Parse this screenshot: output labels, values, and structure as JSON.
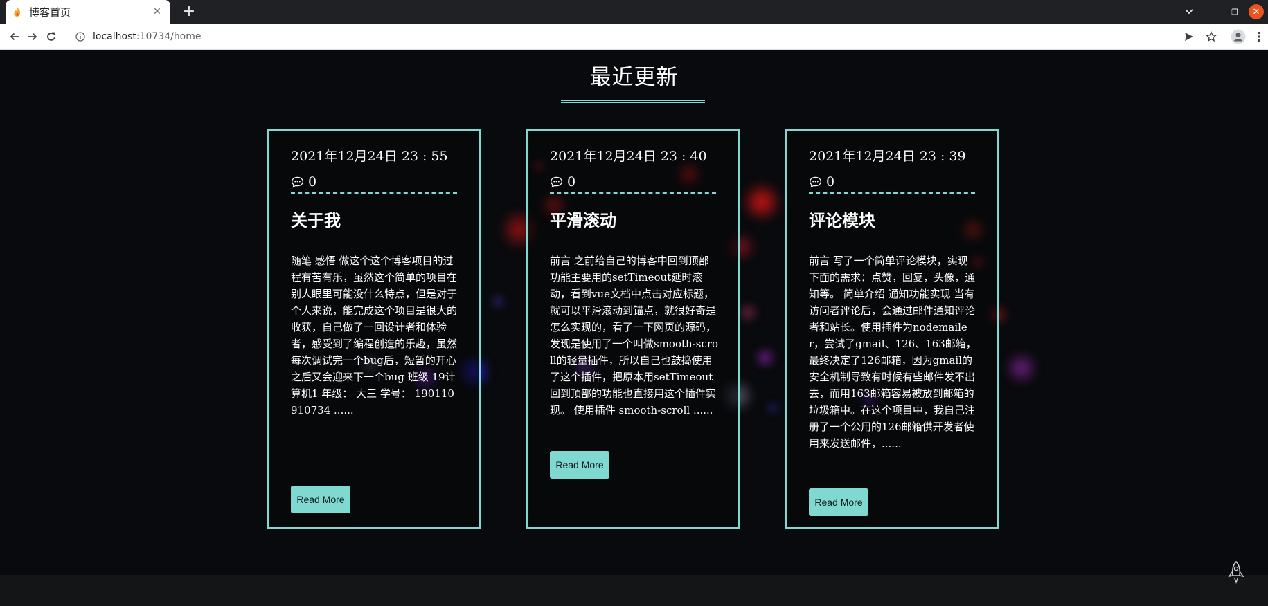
{
  "browser": {
    "tab_title": "博客首页",
    "tab_close": "✕",
    "new_tab": "+",
    "url_host": "localhost",
    "url_rest": ":10734/home",
    "window_controls": {
      "minimize": "–",
      "restore": "❐",
      "close": "✕",
      "list": "⌄"
    }
  },
  "page": {
    "section_title": "最近更新",
    "accent_color": "#7fd9d1",
    "background_color": "#090a0d",
    "cards": [
      {
        "date": "2021年12月24日 23 : 55",
        "comment_count": "0",
        "title": "关于我",
        "excerpt": "随笔 感悟 做这个这个博客项目的过程有苦有乐，虽然这个简单的项目在别人眼里可能没什么特点，但是对于个人来说，能完成这个项目是很大的收获，自己做了一回设计者和体验者，感受到了编程创造的乐趣，虽然每次调试完一个bug后，短暂的开心之后又会迎来下一个bug 班级 19计算机1 年级： 大三 学号： 190110910734 ......",
        "button": "Read More"
      },
      {
        "date": "2021年12月24日 23 : 40",
        "comment_count": "0",
        "title": "平滑滚动",
        "excerpt": "前言 之前给自己的博客中回到顶部功能主要用的setTimeout延时滚动，看到vue文档中点击对应标题，就可以平滑滚动到锚点，就很好奇是怎么实现的，看了一下网页的源码，发现是使用了一个叫做smooth-scroll的轻量插件，所以自己也鼓捣使用了这个插件，把原本用setTimeout回到顶部的功能也直接用这个插件实现。 使用插件 smooth-scroll ......",
        "button": "Read More"
      },
      {
        "date": "2021年12月24日 23 : 39",
        "comment_count": "0",
        "title": "评论模块",
        "excerpt": "前言 写了一个简单评论模块，实现下面的需求：点赞，回复，头像，通知等。 简单介绍 通知功能实现 当有访问者评论后，会通过邮件通知评论者和站长。使用插件为nodemailer，尝试了gmail、126、163邮箱，最终决定了126邮箱，因为gmail的安全机制导致有时候有些邮件发不出去，而用163邮箱容易被放到邮箱的垃圾箱中。在这个项目中，我自己注册了一个公用的126邮箱供开发者使用来发送邮件，......",
        "button": "Read More"
      }
    ]
  },
  "icons": {
    "favicon": "flame-icon",
    "comment": "comment-bubble-icon",
    "back_to_top": "rocket-icon"
  }
}
